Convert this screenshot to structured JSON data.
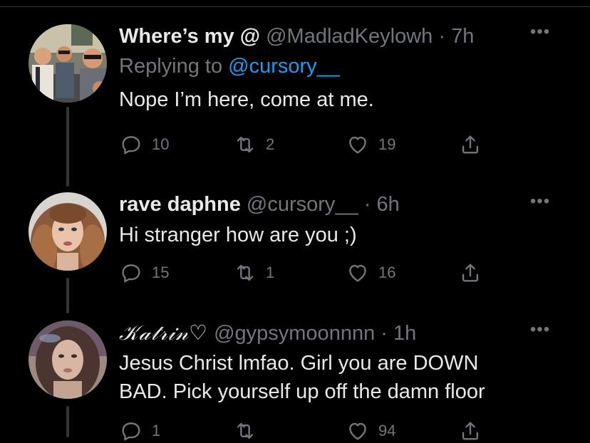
{
  "tweets": [
    {
      "display_name": "Where’s my @",
      "handle": "@MadladKeylowh",
      "separator": "·",
      "time": "7h",
      "replying_prefix": "Replying to",
      "replying_to": "@cursory__",
      "text": "Nope I’m here, come at me.",
      "replies": "10",
      "retweets": "2",
      "likes": "19"
    },
    {
      "display_name": "rave daphne",
      "handle": "@cursory__",
      "separator": "·",
      "time": "6h",
      "text": "Hi stranger how are you ;)",
      "replies": "15",
      "retweets": "1",
      "likes": "16"
    },
    {
      "display_name": "𝒦𝒶𝓉𝓇𝒾𝓃♡",
      "handle": "@gypsymoonnnn",
      "separator": "·",
      "time": "1h",
      "text_line1": "Jesus Christ lmfao. Girl you are DOWN",
      "text_line2": "BAD. Pick yourself up off the damn floor",
      "replies": "1",
      "retweets": "",
      "likes": "94"
    }
  ],
  "icons": {
    "more": "more-horizontal-icon",
    "reply": "reply-icon",
    "retweet": "retweet-icon",
    "like": "heart-icon",
    "share": "share-icon"
  },
  "colors": {
    "background": "#000000",
    "text": "#e7e9ea",
    "secondary": "#71767b",
    "link": "#1d9bf0",
    "thread_line": "#333639"
  }
}
